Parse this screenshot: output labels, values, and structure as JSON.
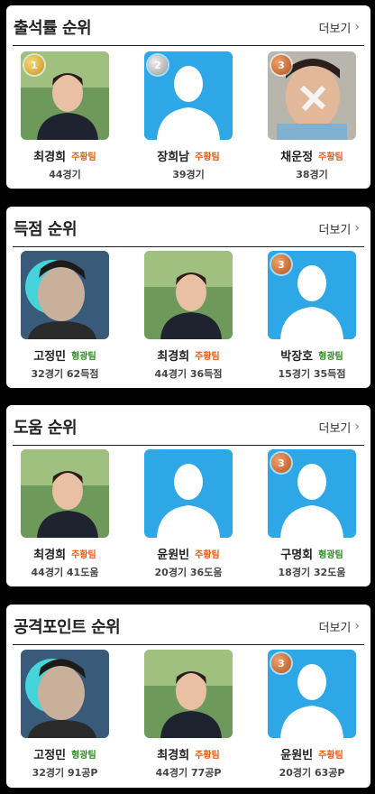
{
  "more_label": "더보기",
  "colors": {
    "orange_team": "#e85b12",
    "green_team": "#2b8a1e",
    "placeholder_bg": "#2ea7e6"
  },
  "sections": [
    {
      "title": "출석률 순위",
      "players": [
        {
          "rank": "1",
          "name": "최경희",
          "team": "주황팀",
          "team_color": "orange",
          "stat": "44경기",
          "photo": "person-photo"
        },
        {
          "rank": "2",
          "name": "장희남",
          "team": "주황팀",
          "team_color": "orange",
          "stat": "39경기",
          "photo": "placeholder"
        },
        {
          "rank": "3",
          "name": "채운정",
          "team": "주황팀",
          "team_color": "orange",
          "stat": "38경기",
          "photo": "person-photo"
        }
      ]
    },
    {
      "title": "득점 순위",
      "players": [
        {
          "rank": "",
          "name": "고정민",
          "team": "형광팀",
          "team_color": "green",
          "stat": "32경기 62득점",
          "photo": "person-photo"
        },
        {
          "rank": "",
          "name": "최경희",
          "team": "주황팀",
          "team_color": "orange",
          "stat": "44경기 36득점",
          "photo": "person-photo"
        },
        {
          "rank": "3",
          "name": "박장호",
          "team": "형광팀",
          "team_color": "green",
          "stat": "15경기 35득점",
          "photo": "placeholder"
        }
      ]
    },
    {
      "title": "도움 순위",
      "players": [
        {
          "rank": "",
          "name": "최경희",
          "team": "주황팀",
          "team_color": "orange",
          "stat": "44경기 41도움",
          "photo": "person-photo"
        },
        {
          "rank": "",
          "name": "윤원빈",
          "team": "주황팀",
          "team_color": "orange",
          "stat": "20경기 36도움",
          "photo": "placeholder"
        },
        {
          "rank": "3",
          "name": "구명회",
          "team": "형광팀",
          "team_color": "green",
          "stat": "18경기 32도움",
          "photo": "placeholder"
        }
      ]
    },
    {
      "title": "공격포인트 순위",
      "players": [
        {
          "rank": "",
          "name": "고정민",
          "team": "형광팀",
          "team_color": "green",
          "stat": "32경기 91공P",
          "photo": "person-photo"
        },
        {
          "rank": "",
          "name": "최경희",
          "team": "주황팀",
          "team_color": "orange",
          "stat": "44경기 77공P",
          "photo": "person-photo"
        },
        {
          "rank": "3",
          "name": "윤원빈",
          "team": "주황팀",
          "team_color": "orange",
          "stat": "20경기 63공P",
          "photo": "placeholder"
        }
      ]
    }
  ]
}
